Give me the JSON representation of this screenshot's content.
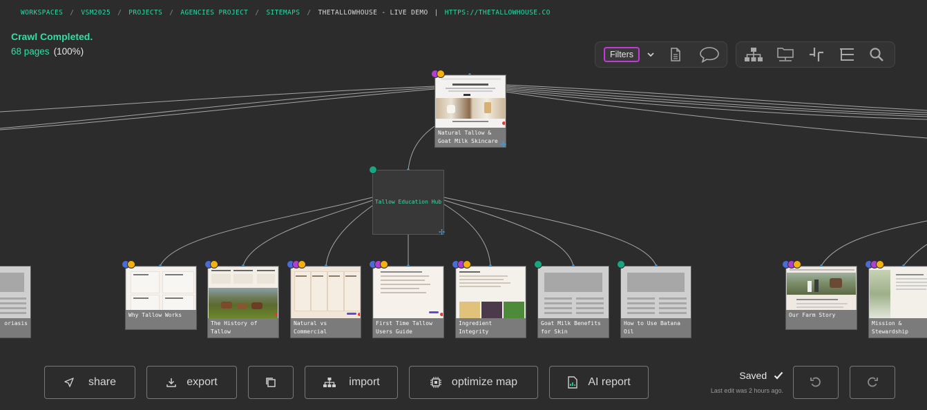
{
  "breadcrumb": {
    "items": [
      "WORKSPACES",
      "VSM2025",
      "PROJECTS",
      "AGENCIES PROJECT",
      "SITEMAPS"
    ],
    "current": "THETALLOWHOUSE - LIVE DEMO",
    "url": "HTTPS://THETALLOWHOUSE.CO"
  },
  "crawl": {
    "status": "Crawl Completed.",
    "pages": "68 pages",
    "percent": "(100%)"
  },
  "toolbar": {
    "filters_label": "Filters",
    "left_icons": [
      "chevron-down-icon",
      "document-icon",
      "comment-icon"
    ],
    "right_icons": [
      "sitemap-tree-icon",
      "folder-network-icon",
      "split-icon",
      "outline-icon",
      "search-icon"
    ]
  },
  "root_node": {
    "label": "Natural Tallow & Goat Milk Skincare"
  },
  "hub_node": {
    "label": "Tallow Education Hub"
  },
  "children": [
    {
      "label": "Why Tallow Works"
    },
    {
      "label": "The History of Tallow"
    },
    {
      "label": "Natural vs Commercial Skincar..."
    },
    {
      "label": "First Time Tallow Users Guide"
    },
    {
      "label": "Ingredient Integrity Standard..."
    },
    {
      "label": "Goat Milk Benefits for Skin"
    },
    {
      "label": "How to Use Batana Oil"
    }
  ],
  "left_partial": {
    "label": "oriasis"
  },
  "right_nodes": [
    {
      "label": "Our Farm Story"
    },
    {
      "label": "Mission & Stewardship"
    }
  ],
  "actions": {
    "share": "share",
    "export": "export",
    "import": "import",
    "optimize": "optimize map",
    "ai_report": "AI report"
  },
  "save_status": {
    "text": "Saved",
    "sub": "Last edit was 2 hours ago."
  },
  "colors": {
    "accent": "#2ed8a6",
    "filters_border": "#c13bd6",
    "link_blue": "#3aa0e0"
  }
}
